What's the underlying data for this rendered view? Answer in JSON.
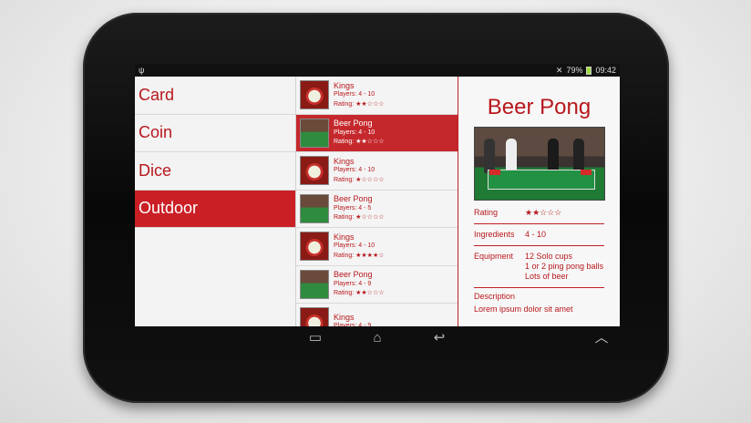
{
  "status": {
    "usb_icon": "usb-icon",
    "signal": "79%",
    "time": "09:42"
  },
  "categories": [
    {
      "label": "Card",
      "selected": false
    },
    {
      "label": "Coin",
      "selected": false
    },
    {
      "label": "Dice",
      "selected": false
    },
    {
      "label": "Outdoor",
      "selected": true
    }
  ],
  "games": [
    {
      "name": "Kings",
      "players": "Players: 4 - 10",
      "rating": "Rating: ★★☆☆☆",
      "thumb": "kings",
      "selected": false
    },
    {
      "name": "Beer Pong",
      "players": "Players: 4 - 10",
      "rating": "Rating: ★★☆☆☆",
      "thumb": "pong",
      "selected": true
    },
    {
      "name": "Kings",
      "players": "Players: 4 - 10",
      "rating": "Rating: ★☆☆☆☆",
      "thumb": "kings",
      "selected": false
    },
    {
      "name": "Beer Pong",
      "players": "Players: 4 - 5",
      "rating": "Rating: ★☆☆☆☆",
      "thumb": "pong",
      "selected": false
    },
    {
      "name": "Kings",
      "players": "Players: 4 - 10",
      "rating": "Rating: ★★★★☆",
      "thumb": "kings",
      "selected": false
    },
    {
      "name": "Beer Pong",
      "players": "Players: 4 - 9",
      "rating": "Rating: ★★☆☆☆",
      "thumb": "pong",
      "selected": false
    },
    {
      "name": "Kings",
      "players": "Players: 4 - 9",
      "rating": "",
      "thumb": "kings",
      "selected": false
    }
  ],
  "detail": {
    "title": "Beer Pong",
    "rating_label": "Rating",
    "rating_value": "★★☆☆☆",
    "ingredients_label": "Ingredients",
    "ingredients_value": "4 - 10",
    "equipment_label": "Equipment",
    "equipment_lines": [
      "12 Solo cups",
      "1 or 2 ping pong balls",
      "Lots of beer"
    ],
    "description_label": "Description",
    "description_text": "Lorem ipsum dolor sit amet"
  },
  "colors": {
    "accent": "#c91f25",
    "text_red": "#b8181d",
    "bezel": "#0d0d0d"
  },
  "nav_icons": [
    "recent-apps-icon",
    "home-icon",
    "back-icon",
    "menu-up-icon"
  ]
}
